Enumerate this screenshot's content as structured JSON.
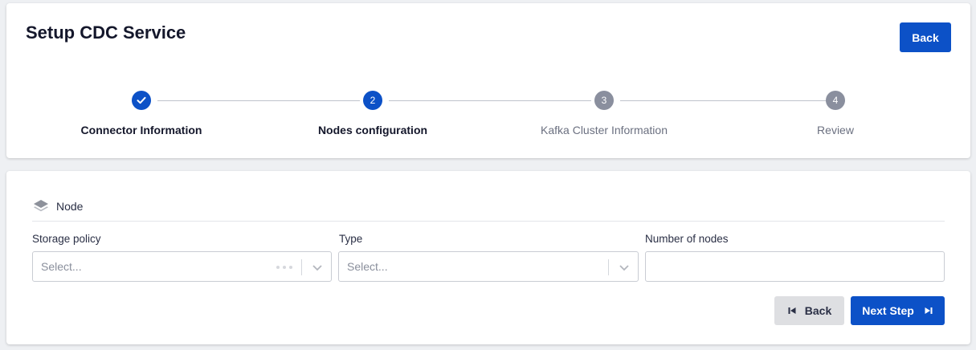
{
  "header": {
    "title": "Setup CDC Service",
    "back_label": "Back"
  },
  "stepper": {
    "steps": [
      {
        "number": "",
        "label": "Connector Information",
        "state": "completed"
      },
      {
        "number": "2",
        "label": "Nodes configuration",
        "state": "active"
      },
      {
        "number": "3",
        "label": "Kafka Cluster Information",
        "state": "pending"
      },
      {
        "number": "4",
        "label": "Review",
        "state": "pending"
      }
    ]
  },
  "form": {
    "section_title": "Node",
    "storage_policy": {
      "label": "Storage policy",
      "placeholder": "Select..."
    },
    "type": {
      "label": "Type",
      "placeholder": "Select..."
    },
    "number_of_nodes": {
      "label": "Number of nodes",
      "value": ""
    },
    "back_label": "Back",
    "next_label": "Next Step"
  },
  "colors": {
    "primary": "#0c51c7",
    "pending": "#8a8f9e",
    "background": "#eef0f3"
  }
}
